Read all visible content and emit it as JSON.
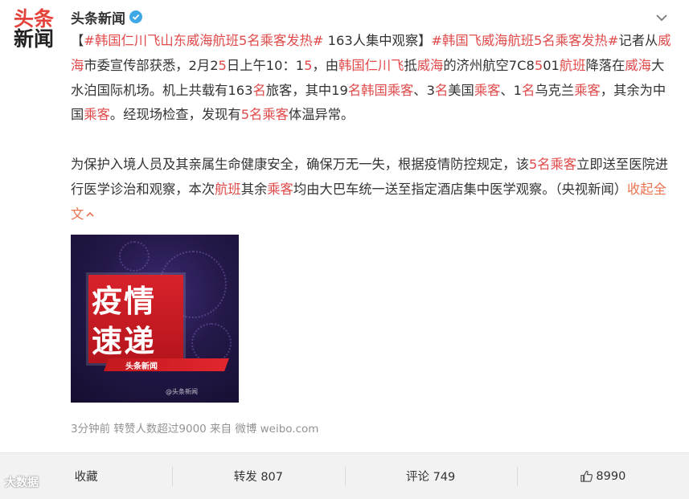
{
  "avatar": {
    "line1": "头条",
    "line2": "新闻"
  },
  "author": {
    "name": "头条新闻",
    "verified_icon": "verified-badge-icon"
  },
  "post": {
    "p1": [
      {
        "t": "【",
        "c": ""
      },
      {
        "t": "#韩国仁川飞山东威海航班5名乘客发热#",
        "c": "tag"
      },
      {
        "t": " 163人集中观察】",
        "c": ""
      },
      {
        "t": "#韩国飞威海航班5名乘客发热#",
        "c": "tag"
      },
      {
        "t": "记者从",
        "c": ""
      },
      {
        "t": "威海",
        "c": "hl"
      },
      {
        "t": "市委宣传部获悉，2月2",
        "c": ""
      },
      {
        "t": "5",
        "c": "hl"
      },
      {
        "t": "日上午10：1",
        "c": ""
      },
      {
        "t": "5",
        "c": "hl"
      },
      {
        "t": "，由",
        "c": ""
      },
      {
        "t": "韩国仁川飞",
        "c": "hl"
      },
      {
        "t": "抵",
        "c": ""
      },
      {
        "t": "威海",
        "c": "hl"
      },
      {
        "t": "的济州航空7C8",
        "c": ""
      },
      {
        "t": "5",
        "c": "hl"
      },
      {
        "t": "01",
        "c": ""
      },
      {
        "t": "航班",
        "c": "hl"
      },
      {
        "t": "降落在",
        "c": ""
      },
      {
        "t": "威海",
        "c": "hl"
      },
      {
        "t": "大水泊国际机场。机上共载有163",
        "c": ""
      },
      {
        "t": "名",
        "c": "hl"
      },
      {
        "t": "旅客，其中19",
        "c": ""
      },
      {
        "t": "名韩国乘客",
        "c": "hl"
      },
      {
        "t": "、3",
        "c": ""
      },
      {
        "t": "名",
        "c": "hl"
      },
      {
        "t": "美国",
        "c": ""
      },
      {
        "t": "乘客",
        "c": "hl"
      },
      {
        "t": "、1",
        "c": ""
      },
      {
        "t": "名",
        "c": "hl"
      },
      {
        "t": "乌克兰",
        "c": ""
      },
      {
        "t": "乘客",
        "c": "hl"
      },
      {
        "t": "，其余为中国",
        "c": ""
      },
      {
        "t": "乘客",
        "c": "hl"
      },
      {
        "t": "。经现场检查，发现有",
        "c": ""
      },
      {
        "t": "5名乘客",
        "c": "hl"
      },
      {
        "t": "体温异常。",
        "c": ""
      }
    ],
    "p2": [
      {
        "t": "为保护入境人员及其亲属生命健康安全，确保万无一失，根据疫情防控规定，该",
        "c": ""
      },
      {
        "t": "5名乘客",
        "c": "hl"
      },
      {
        "t": "立即送至医院进行医学诊治和观察，本次",
        "c": ""
      },
      {
        "t": "航班",
        "c": "hl"
      },
      {
        "t": "其余",
        "c": ""
      },
      {
        "t": "乘客",
        "c": "hl"
      },
      {
        "t": "均由大巴车统一送至指定酒店集中医学观察。（央视新闻）",
        "c": ""
      }
    ],
    "collapse_label": "收起全文",
    "collapse_icon": "chevron-up-icon"
  },
  "image": {
    "line1": "疫情",
    "line2": "速递",
    "strip": "头条新闻",
    "watermark": "@头条新闻"
  },
  "meta": {
    "time": "3分钟前",
    "reposts_note": "转赞人数超过9000",
    "source": "来自 微博 weibo.com"
  },
  "actions": {
    "favorite": "收藏",
    "repost": "转发 807",
    "comment": "评论 749",
    "like_count": "8990",
    "like_icon": "thumbs-up-icon"
  },
  "footer": {
    "logo_text": "大数据"
  },
  "colors": {
    "highlight": "#e04a4a",
    "fold": "#eb7350",
    "meta": "#939393",
    "action_bar": "#f2f2f2",
    "verified": "#3ea8e6"
  }
}
